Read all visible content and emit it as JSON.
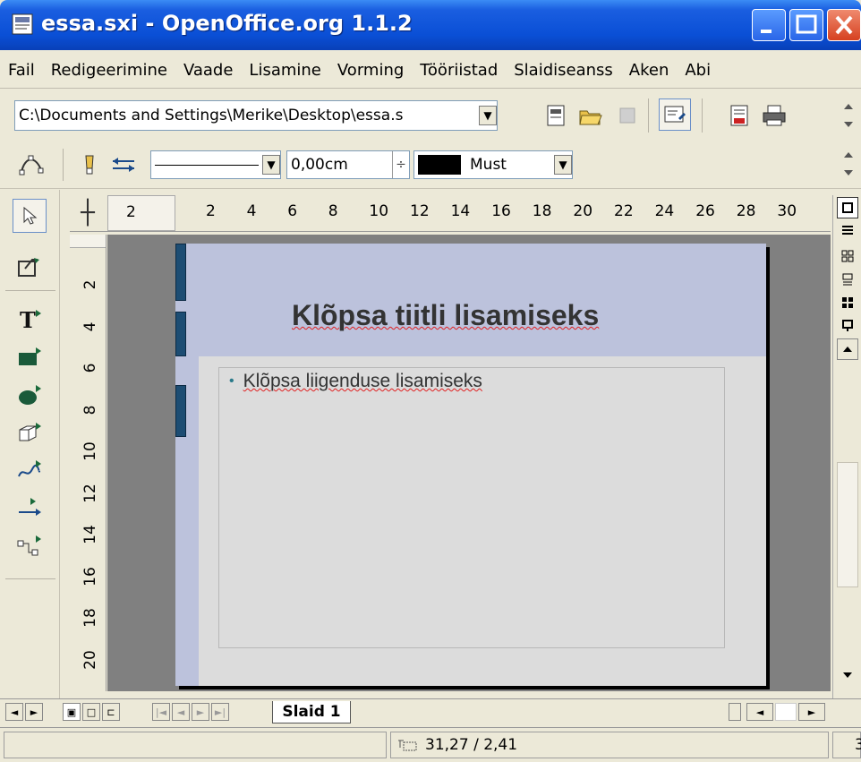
{
  "window": {
    "title": "essa.sxi - OpenOffice.org 1.1.2",
    "app_icon": "impress-document-icon"
  },
  "menu": [
    "Fail",
    "Redigeerimine",
    "Vaade",
    "Lisamine",
    "Vorming",
    "Tööriistad",
    "Slaidiseanss",
    "Aken",
    "Abi"
  ],
  "toolbar1": {
    "path_value": "C:\\Documents and Settings\\Merike\\Desktop\\essa.s",
    "icons": [
      "edit-file-icon",
      "open-folder-icon",
      "disabled-icon",
      "edit-mode-icon",
      "pdf-export-icon",
      "print-icon"
    ]
  },
  "toolbar2": {
    "line_width": "0,00cm",
    "line_color": "Must",
    "line_color_hex": "#000000"
  },
  "hruler": {
    "left_label": "2",
    "ticks": [
      "2",
      "4",
      "6",
      "8",
      "10",
      "12",
      "14",
      "16",
      "18",
      "20",
      "22",
      "24",
      "26",
      "28",
      "30"
    ]
  },
  "vruler": {
    "ticks": [
      "2",
      "4",
      "6",
      "8",
      "10",
      "12",
      "14",
      "16",
      "18",
      "20"
    ]
  },
  "slide": {
    "title": "Klõpsa tiitli lisamiseks",
    "outline": "Klõpsa liigenduse lisamiseks",
    "header_color": "#bcc2dc",
    "bar_color": "#1d4d73"
  },
  "tabs": {
    "active": "Slaid 1"
  },
  "status": {
    "position": "31,27 / 2,41",
    "right": "3"
  }
}
